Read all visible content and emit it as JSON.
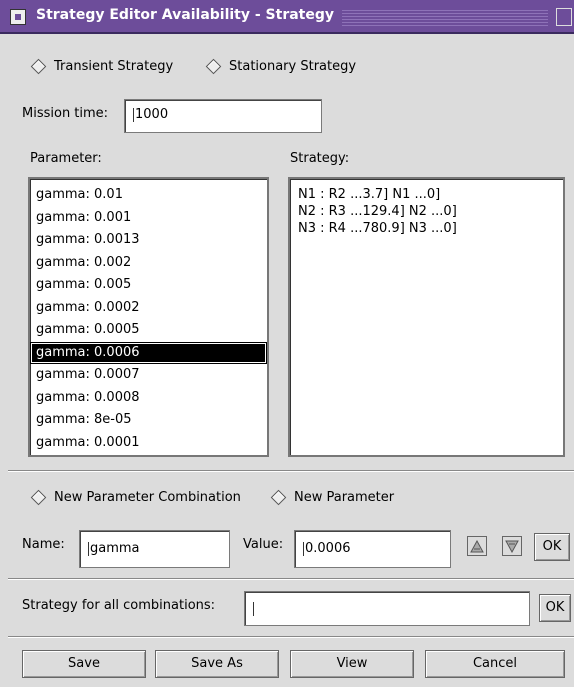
{
  "window": {
    "title": "Strategy Editor  Availability - Strategy"
  },
  "strategy_mode": {
    "options": [
      "Transient Strategy",
      "Stationary Strategy"
    ]
  },
  "mission_time": {
    "label": "Mission time:",
    "value": "1000"
  },
  "parameter": {
    "label": "Parameter:",
    "items": [
      "gamma: 0.01",
      "gamma: 0.001",
      "gamma: 0.0013",
      "gamma: 0.002",
      "gamma: 0.005",
      "gamma: 0.0002",
      "gamma: 0.0005",
      "gamma: 0.0006",
      "gamma: 0.0007",
      "gamma: 0.0008",
      "gamma: 8e-05",
      "gamma: 0.0001"
    ],
    "selected": "gamma: 0.0006"
  },
  "strategy": {
    "label": "Strategy:",
    "items": [
      "N1 : R2 ...3.7] N1 ...0]",
      "N2 : R3 ...129.4] N2 ...0]",
      "N3 : R4 ...780.9] N3 ...0]"
    ]
  },
  "param_mode": {
    "options": [
      "New Parameter Combination",
      "New Parameter"
    ]
  },
  "edit": {
    "name_label": "Name:",
    "name_value": "gamma",
    "value_label": "Value:",
    "value_value": "0.0006",
    "ok_label": "OK"
  },
  "all_combinations": {
    "label": "Strategy for all combinations:",
    "value": "",
    "ok_label": "OK"
  },
  "footer": {
    "save": "Save",
    "save_as": "Save As",
    "view": "View",
    "cancel": "Cancel"
  },
  "icons": {
    "window_menu": "window-menu-icon",
    "up": "triangle-up-icon",
    "down": "triangle-down-icon"
  }
}
